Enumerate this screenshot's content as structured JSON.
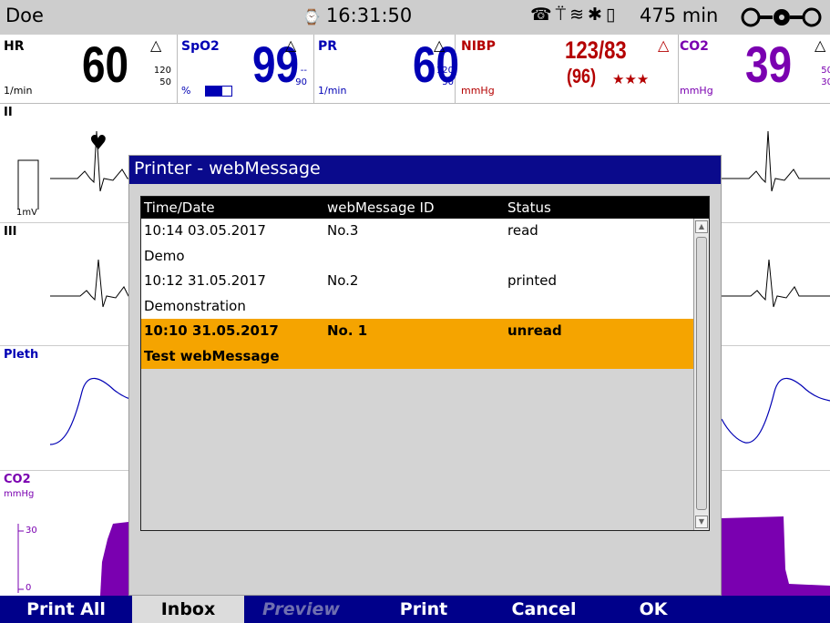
{
  "status_bar": {
    "patient_name": "Doe",
    "clock_icon": "clock-icon",
    "time": "16:31:50",
    "battery_runtime": "475 min",
    "icons": [
      "phone-icon",
      "antenna-icon",
      "wifi-icon",
      "bluetooth-icon",
      "battery-icon",
      "connection-icon"
    ]
  },
  "parameters": {
    "hr": {
      "label": "HR",
      "unit": "1/min",
      "value": "60",
      "limit_high": "120",
      "limit_low": "50",
      "color": "#000000"
    },
    "spo2": {
      "label": "SpO2",
      "unit": "%",
      "value": "99",
      "limit_high": "--",
      "limit_low": "90",
      "color": "#0000b4"
    },
    "pr": {
      "label": "PR",
      "unit": "1/min",
      "value": "60",
      "limit_high": "120",
      "limit_low": "50",
      "color": "#0000b4"
    },
    "nibp": {
      "label": "NIBP",
      "unit": "mmHg",
      "value": "123/83",
      "mean": "(96)",
      "quality": "★★★",
      "color": "#b40000"
    },
    "co2": {
      "label": "CO2",
      "unit": "mmHg",
      "value": "39",
      "limit_high": "50",
      "limit_low": "30",
      "color": "#7a00b0"
    }
  },
  "waveforms": {
    "ecg_ii": {
      "label": "II",
      "scale": "1mV"
    },
    "ecg_iii": {
      "label": "III"
    },
    "pleth": {
      "label": "Pleth"
    },
    "co2": {
      "label": "CO2",
      "unit": "mmHg",
      "tick_high": "30",
      "tick_low": "0"
    }
  },
  "dialog": {
    "title": "Printer - webMessage",
    "columns": [
      "Time/Date",
      "webMessage ID",
      "Status"
    ],
    "rows": [
      {
        "time_date": "10:14 03.05.2017",
        "id": "No.3",
        "status": "read",
        "text": "Demo",
        "selected": false
      },
      {
        "time_date": "10:12 31.05.2017",
        "id": "No.2",
        "status": "printed",
        "text": "Demonstration",
        "selected": false
      },
      {
        "time_date": "10:10 31.05.2017",
        "id": "No. 1",
        "status": "unread",
        "text": "Test webMessage",
        "selected": true
      }
    ]
  },
  "softkeys": {
    "print_all": "Print All",
    "inbox": "Inbox",
    "preview": "Preview",
    "print": "Print",
    "cancel": "Cancel",
    "ok": "OK"
  }
}
